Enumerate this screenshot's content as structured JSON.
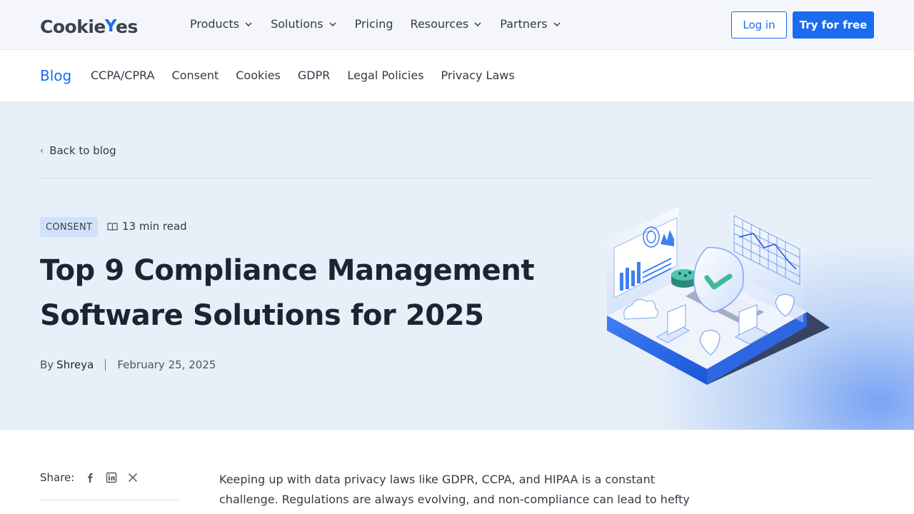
{
  "header": {
    "logo_text": "Cookie",
    "logo_check": "Y",
    "logo_end": "es",
    "menu": [
      {
        "label": "Products",
        "dropdown": true
      },
      {
        "label": "Solutions",
        "dropdown": true
      },
      {
        "label": "Pricing",
        "dropdown": false
      },
      {
        "label": "Resources",
        "dropdown": true
      },
      {
        "label": "Partners",
        "dropdown": true
      }
    ],
    "login_label": "Log in",
    "try_label": "Try for free"
  },
  "subnav": {
    "blog_label": "Blog",
    "links": [
      "CCPA/CPRA",
      "Consent",
      "Cookies",
      "GDPR",
      "Legal Policies",
      "Privacy Laws"
    ]
  },
  "hero": {
    "back_label": "Back to blog",
    "tag": "CONSENT",
    "read_time": "13 min read",
    "title": "Top 9 Compliance Management Software Solutions for 2025",
    "by_label": "By",
    "author": "Shreya",
    "date": "February 25, 2025"
  },
  "share": {
    "label": "Share:",
    "icons": [
      "facebook-icon",
      "linkedin-icon",
      "x-icon"
    ]
  },
  "article": {
    "intro": "Keeping up with data privacy laws like GDPR, CCPA, and HIPAA is a constant challenge. Regulations are always evolving, and non-compliance can lead to hefty"
  },
  "colors": {
    "brand": "#1a6bf0",
    "tag_bg": "#d1e1fb",
    "hero_bg": "#e7eff8"
  }
}
